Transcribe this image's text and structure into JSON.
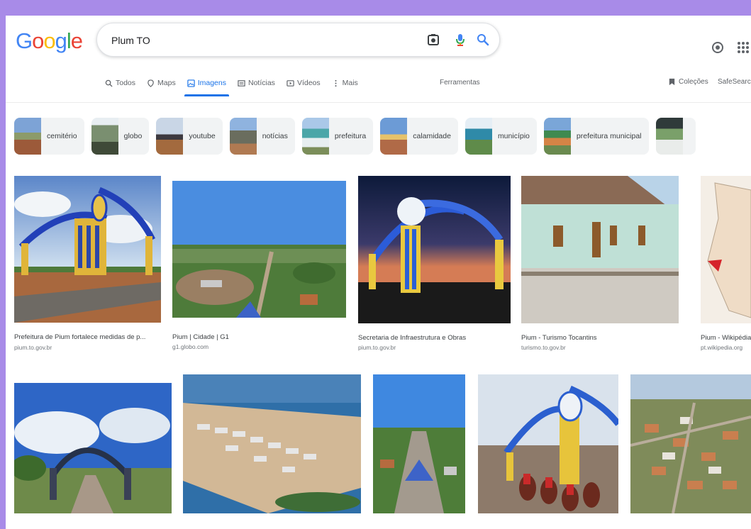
{
  "header": {
    "logo_letters": [
      "G",
      "o",
      "o",
      "g",
      "l",
      "e"
    ],
    "logo_colors": [
      "#4285f4",
      "#ea4335",
      "#fbbc05",
      "#4285f4",
      "#34a853",
      "#ea4335"
    ],
    "search_value": "Plum TO"
  },
  "tabs": [
    {
      "label": "Todos",
      "icon": "search-icon"
    },
    {
      "label": "Maps",
      "icon": "map-pin-icon"
    },
    {
      "label": "Imagens",
      "icon": "image-icon",
      "active": true
    },
    {
      "label": "Notícias",
      "icon": "news-icon"
    },
    {
      "label": "Vídeos",
      "icon": "video-icon"
    },
    {
      "label": "Mais",
      "icon": "more-icon"
    }
  ],
  "tools_label": "Ferramentas",
  "collections_label": "Coleções",
  "safesearch_label": "SafeSearch",
  "chips": [
    "cemitério",
    "globo",
    "youtube",
    "notícias",
    "prefeitura",
    "calamidade",
    "município",
    "prefeitura municipal"
  ],
  "results_row1": [
    {
      "title": "Prefeitura de Pium fortalece medidas de p...",
      "site": "pium.to.gov.br"
    },
    {
      "title": "Pium | Cidade | G1",
      "site": "g1.globo.com"
    },
    {
      "title": "Secretaria de Infraestrutura e Obras",
      "site": "pium.to.gov.br"
    },
    {
      "title": "Pium - Turismo Tocantins",
      "site": "turismo.to.gov.br"
    },
    {
      "title": "Pium - Wikipédia, ...",
      "site": "pt.wikipedia.org"
    }
  ],
  "colors": {
    "accent": "#1a73e8",
    "background": "#a88be8"
  }
}
